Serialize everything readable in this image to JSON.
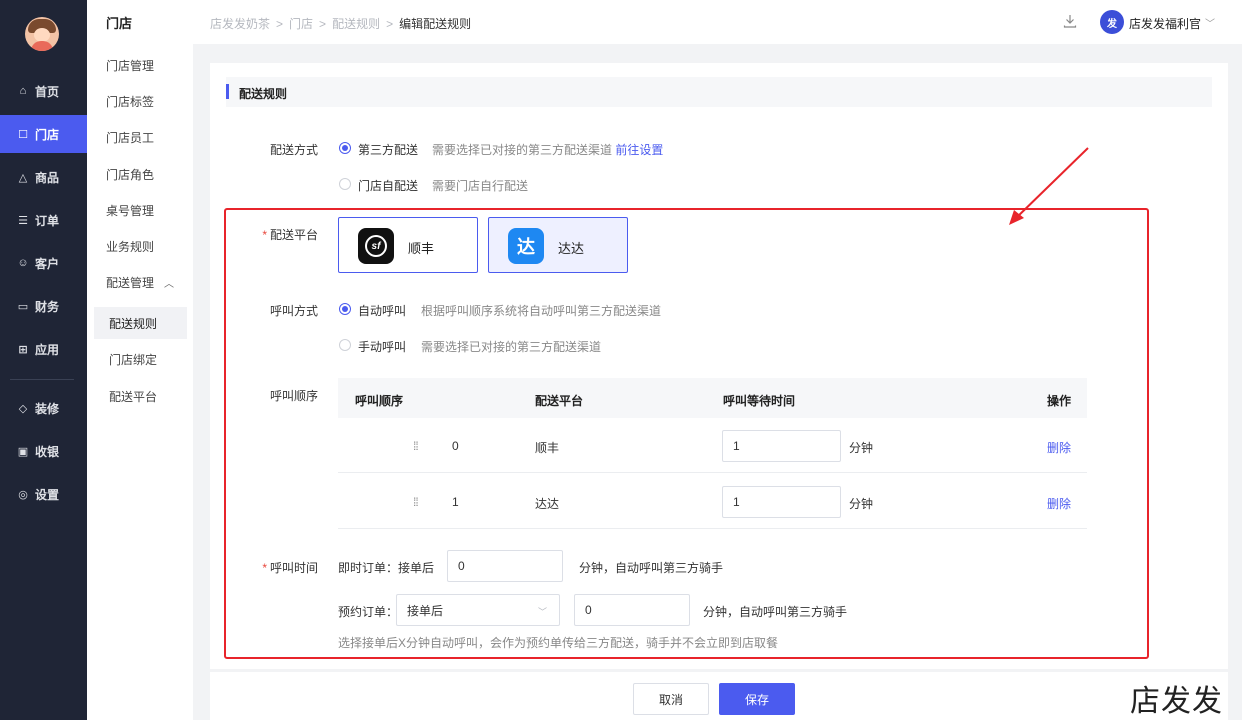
{
  "nav": {
    "items": [
      {
        "icon": "home-icon",
        "glyph": "⌂",
        "label": "首页"
      },
      {
        "icon": "store-icon",
        "glyph": "☐",
        "label": "门店"
      },
      {
        "icon": "bag-icon",
        "glyph": "△",
        "label": "商品"
      },
      {
        "icon": "order-icon",
        "glyph": "☰",
        "label": "订单"
      },
      {
        "icon": "user-icon",
        "glyph": "☺",
        "label": "客户"
      },
      {
        "icon": "wallet-icon",
        "glyph": "▭",
        "label": "财务"
      },
      {
        "icon": "apps-icon",
        "glyph": "⊞",
        "label": "应用"
      },
      {
        "icon": "decorate-icon",
        "glyph": "◇",
        "label": "装修"
      },
      {
        "icon": "cashier-icon",
        "glyph": "▣",
        "label": "收银"
      },
      {
        "icon": "settings-icon",
        "glyph": "◎",
        "label": "设置"
      }
    ]
  },
  "subnav": {
    "title": "门店",
    "items": [
      "门店管理",
      "门店标签",
      "门店员工",
      "门店角色",
      "桌号管理",
      "业务规则",
      "配送管理"
    ],
    "children": [
      "配送规则",
      "门店绑定",
      "配送平台"
    ]
  },
  "header": {
    "crumbs": [
      "店发发奶茶",
      "门店",
      "配送规则",
      "编辑配送规则"
    ],
    "brand_logo": "发",
    "brand_name": "店发发福利官"
  },
  "section": {
    "title": "配送规则"
  },
  "delivery_method": {
    "label": "配送方式",
    "options": [
      {
        "label": "第三方配送",
        "hint": "需要选择已对接的第三方配送渠道",
        "link": "前往设置"
      },
      {
        "label": "门店自配送",
        "hint": "需要门店自行配送"
      }
    ]
  },
  "platform": {
    "label": "配送平台",
    "cards": [
      {
        "name": "顺丰",
        "logo": "sf"
      },
      {
        "name": "达达",
        "logo": "达"
      }
    ]
  },
  "call_mode": {
    "label": "呼叫方式",
    "options": [
      {
        "label": "自动呼叫",
        "hint": "根据呼叫顺序系统将自动呼叫第三方配送渠道"
      },
      {
        "label": "手动呼叫",
        "hint": "需要选择已对接的第三方配送渠道"
      }
    ]
  },
  "call_order": {
    "label": "呼叫顺序",
    "columns": [
      "呼叫顺序",
      "配送平台",
      "呼叫等待时间",
      "操作"
    ],
    "rows": [
      {
        "order": "0",
        "platform": "顺丰",
        "wait": "1",
        "unit": "分钟",
        "action": "删除"
      },
      {
        "order": "1",
        "platform": "达达",
        "wait": "1",
        "unit": "分钟",
        "action": "删除"
      }
    ]
  },
  "call_time": {
    "label": "呼叫时间",
    "instant_label": "即时订单：接单后",
    "instant_value": "0",
    "instant_suffix": "分钟，自动呼叫第三方骑手",
    "scheduled_label": "预约订单：",
    "scheduled_select": "接单后",
    "scheduled_value": "0",
    "scheduled_suffix": "分钟，自动呼叫第三方骑手",
    "note": "选择接单后X分钟自动呼叫，会作为预约单传给三方配送，骑手并不会立即到店取餐"
  },
  "footer": {
    "cancel": "取消",
    "save": "保存"
  },
  "watermark": "店发发",
  "colors": {
    "accent": "#4b5bef",
    "sidebar": "#1f2536",
    "annotation": "#e8242b"
  }
}
